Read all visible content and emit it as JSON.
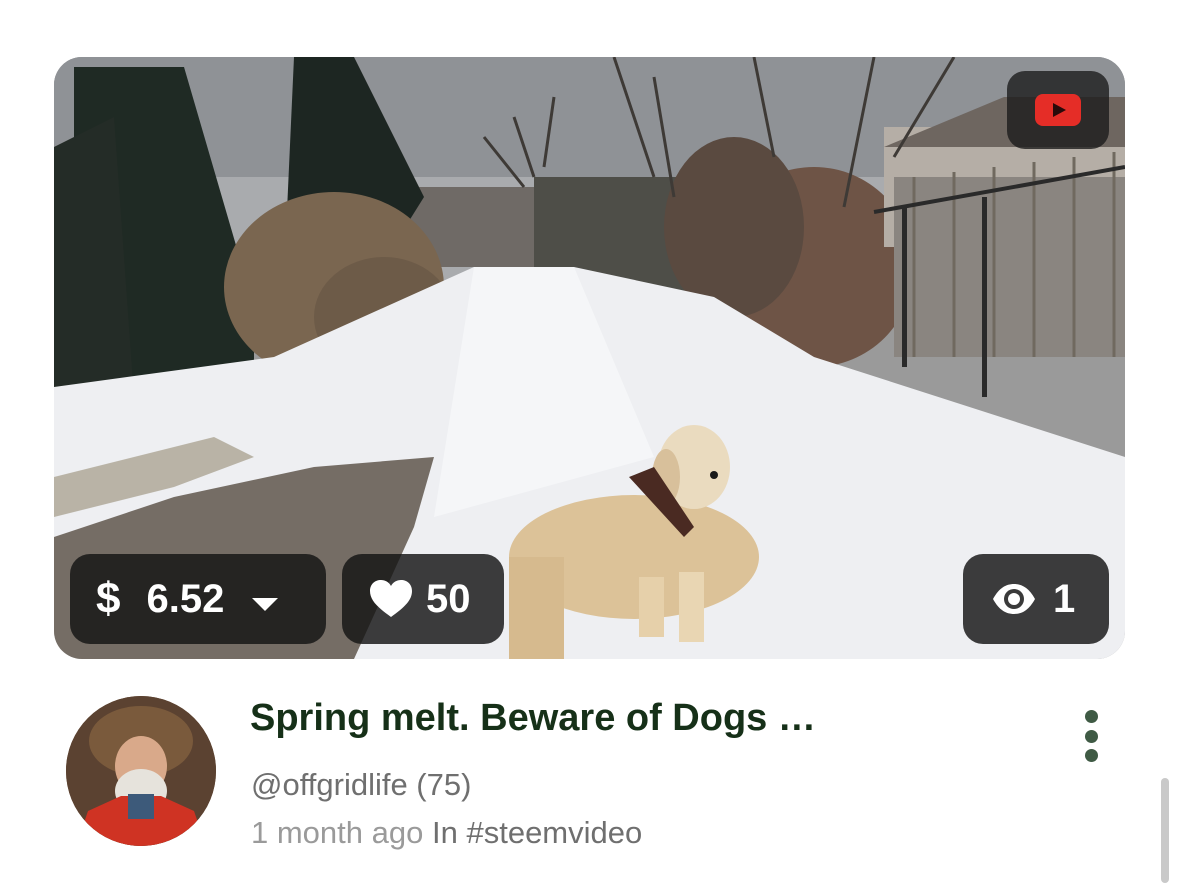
{
  "video": {
    "source_icon": "youtube-icon",
    "payout": "6.52",
    "currency_symbol": "$",
    "likes": "50",
    "views": "1"
  },
  "post": {
    "title": "Spring melt. Beware of Dogs …",
    "author": "@offgridlife (75)",
    "age": "1 month ago",
    "category_prefix": "In",
    "category": "#steemvideo"
  },
  "icons": {
    "payout_dropdown": "caret-down-icon",
    "likes": "heart-icon",
    "views": "eye-icon",
    "more": "kebab-menu-icon"
  },
  "colors": {
    "title": "#163018",
    "youtube_red": "#e52d27",
    "pill_bg": "#141414"
  }
}
